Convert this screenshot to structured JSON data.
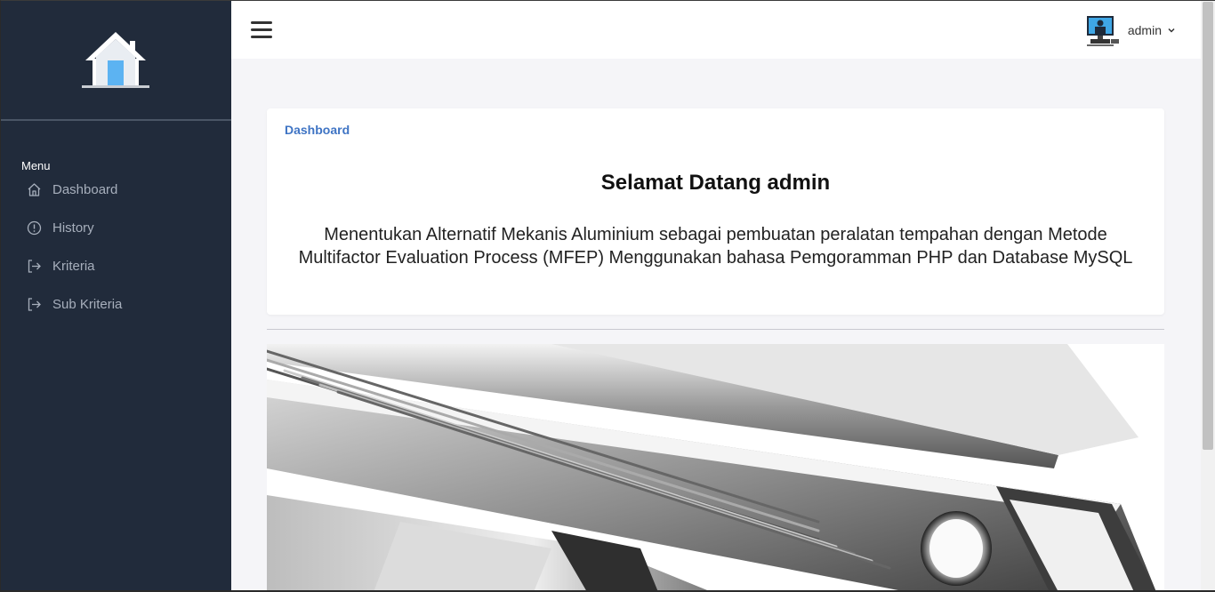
{
  "sidebar": {
    "menu_heading": "Menu",
    "items": [
      {
        "label": "Dashboard",
        "icon": "home-icon"
      },
      {
        "label": "History",
        "icon": "info-circle-icon"
      },
      {
        "label": "Kriteria",
        "icon": "sign-out-icon"
      },
      {
        "label": "Sub Kriteria",
        "icon": "sign-out-icon"
      }
    ]
  },
  "header": {
    "user_name": "admin"
  },
  "main": {
    "breadcrumb": "Dashboard",
    "welcome": "Selamat Datang admin",
    "description": "Menentukan Alternatif Mekanis Aluminium sebagai pembuatan peralatan tempahan dengan Metode Multifactor Evaluation Process (MFEP) Menggunakan bahasa Pemgoramman PHP dan Database MySQL"
  },
  "colors": {
    "sidebar_bg": "#212b3b",
    "accent": "#3f74c4",
    "page_bg": "#f5f5f8"
  }
}
